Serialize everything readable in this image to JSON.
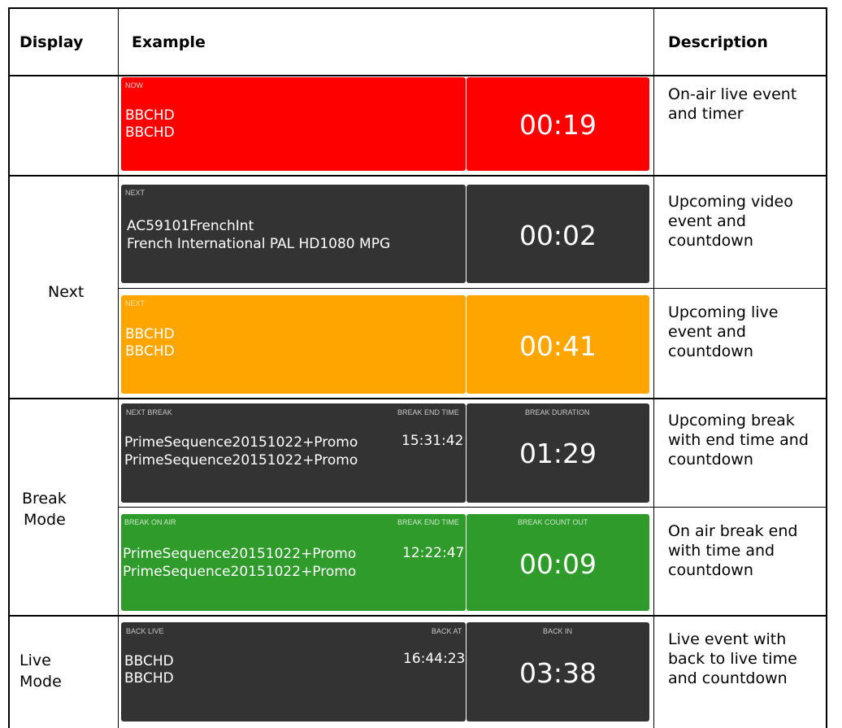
{
  "table": {
    "headers": {
      "display": "Display",
      "example": "Example",
      "description": "Description"
    },
    "rows": [
      {
        "display": "",
        "panel": {
          "label": "NOW",
          "line1": "BBCHD",
          "line2": "BBCHD",
          "timer": "00:19"
        },
        "description": [
          "On-air live event",
          "and timer"
        ]
      },
      {
        "display": "Next",
        "panel": {
          "label": "NEXT",
          "line1": "AC59101FrenchInt",
          "line2": "French International PAL HD1080 MPG",
          "timer": "00:02"
        },
        "description": [
          "Upcoming video",
          "event and",
          "countdown"
        ]
      },
      {
        "panel": {
          "label": "NEXT",
          "line1": "BBCHD",
          "line2": "BBCHD",
          "timer": "00:41"
        },
        "description": [
          "Upcoming live",
          "event and",
          "countdown"
        ]
      },
      {
        "display": [
          "Break",
          "Mode"
        ],
        "panel": {
          "label": "NEXT BREAK",
          "end_label": "BREAK END TIME",
          "end_time": "15:31:42",
          "timer_label": "BREAK DURATION",
          "line1": "PrimeSequence20151022+Promo",
          "line2": "PrimeSequence20151022+Promo",
          "timer": "01:29"
        },
        "description": [
          "Upcoming break",
          "with end time and",
          "countdown"
        ]
      },
      {
        "panel": {
          "label": "BREAK ON AIR",
          "end_label": "BREAK END TIME",
          "end_time": "12:22:47",
          "timer_label": "BREAK COUNT OUT",
          "line1": "PrimeSequence20151022+Promo",
          "line2": "PrimeSequence20151022+Promo",
          "timer": "00:09"
        },
        "description": [
          "On air break end",
          "with time and",
          "countdown"
        ]
      },
      {
        "display": [
          "Live",
          "Mode"
        ],
        "panel": {
          "label": "BACK LIVE",
          "end_label": "BACK AT",
          "end_time": "16:44:23",
          "timer_label": "BACK IN",
          "line1": "BBCHD",
          "line2": "BBCHD",
          "timer": "03:38"
        },
        "description": [
          "Live event with",
          "back to live time",
          "and countdown"
        ]
      }
    ]
  },
  "colors": {
    "now": "#ff0000",
    "idle": "#333333",
    "next_live": "#ffa500",
    "break_on_air": "#2e9b2a"
  }
}
